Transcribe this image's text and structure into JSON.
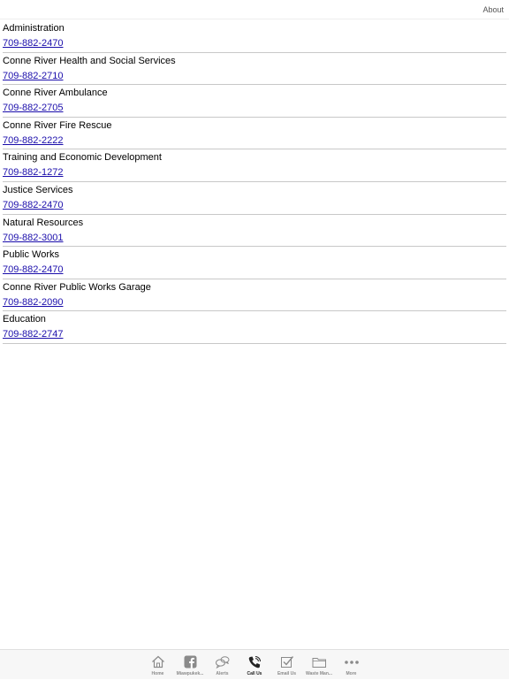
{
  "header": {
    "about_label": "About"
  },
  "contacts": [
    {
      "name": "Administration",
      "phone": "709-882-2470"
    },
    {
      "name": "Conne River Health and Social Services",
      "phone": "709-882-2710"
    },
    {
      "name": "Conne River Ambulance",
      "phone": "709-882-2705"
    },
    {
      "name": "Conne River Fire Rescue",
      "phone": "709-882-2222"
    },
    {
      "name": "Training and Economic Development",
      "phone": "709-882-1272"
    },
    {
      "name": "Justice Services",
      "phone": "709-882-2470"
    },
    {
      "name": "Natural Resources",
      "phone": "709-882-3001"
    },
    {
      "name": "Public Works",
      "phone": "709-882-2470"
    },
    {
      "name": "Conne River Public Works Garage",
      "phone": "709-882-2090"
    },
    {
      "name": "Education",
      "phone": "709-882-2747"
    }
  ],
  "tabs": [
    {
      "label": "Home",
      "icon": "home-icon",
      "active": false
    },
    {
      "label": "Miawpukek...",
      "icon": "facebook-icon",
      "active": false
    },
    {
      "label": "Alerts",
      "icon": "chat-bubbles-icon",
      "active": false
    },
    {
      "label": "Call Us",
      "icon": "phone-icon",
      "active": true
    },
    {
      "label": "Email Us",
      "icon": "checkbox-icon",
      "active": false
    },
    {
      "label": "Waste Man...",
      "icon": "folder-icon",
      "active": false
    },
    {
      "label": "More",
      "icon": "more-dots-icon",
      "active": false
    }
  ],
  "colors": {
    "link": "#1a0dab",
    "divider": "#c8c8c8",
    "tab_inactive": "#8a8a8a",
    "tab_active": "#222222"
  }
}
